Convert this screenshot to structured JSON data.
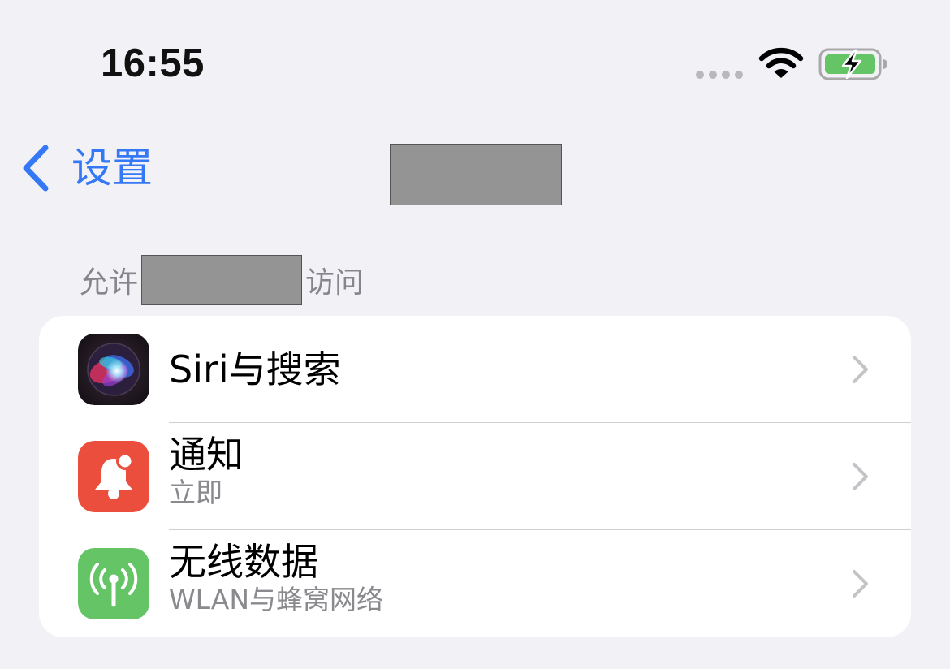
{
  "status_bar": {
    "time": "16:55",
    "icons": [
      "signal-dots-icon",
      "wifi-icon",
      "battery-charging-icon"
    ],
    "battery_color": "#65c466"
  },
  "nav": {
    "back_label": "设置",
    "title_redacted": true
  },
  "section": {
    "prefix": "允许",
    "suffix": "访问"
  },
  "rows": [
    {
      "title": "Siri与搜索",
      "subtitle": "",
      "icon": "siri-icon"
    },
    {
      "title": "通知",
      "subtitle": "立即",
      "icon": "notifications-icon",
      "icon_color": "#eb4e3d"
    },
    {
      "title": "无线数据",
      "subtitle": "WLAN与蜂窝网络",
      "icon": "antenna-icon",
      "icon_color": "#65c466"
    }
  ],
  "colors": {
    "accent": "#3478f6",
    "background": "#f2f1f6",
    "secondary_text": "#86858b"
  }
}
